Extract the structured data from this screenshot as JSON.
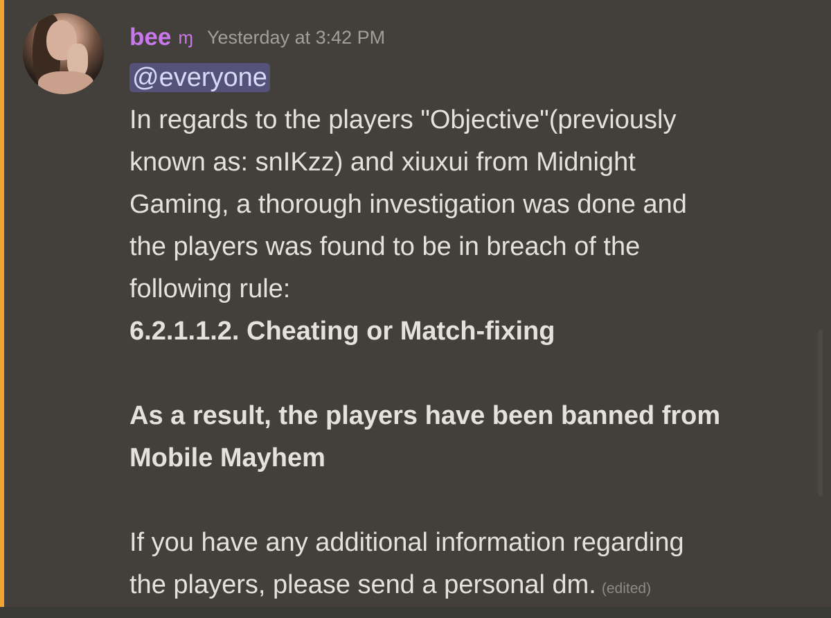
{
  "message": {
    "username": "bee",
    "name_icon": "ɱ",
    "timestamp": "Yesterday at 3:42 PM",
    "mention": "@everyone",
    "paragraph1": [
      "In regards to the players \"Objective\"(previously",
      "known as: snIKzz) and xiuxui from Midnight",
      "Gaming, a thorough investigation was done and",
      "the players was found to be in breach of the",
      "following rule:"
    ],
    "rule": "6.2.1.1.2. Cheating or Match-fixing",
    "result": [
      "As a result, the players have been banned from",
      "Mobile Mayhem"
    ],
    "closing": [
      "If you have any additional information regarding",
      "the players, please send a personal dm."
    ],
    "edited": "(edited)"
  },
  "colors": {
    "username": "#c978ec",
    "mention_bar": "#f0a532",
    "mention_bg": "#55527a",
    "background": "#433f3b",
    "text": "#e4e2dc"
  },
  "icons": {
    "name_icon": "curly-m-glyph",
    "avatar": "user-avatar-photo"
  }
}
